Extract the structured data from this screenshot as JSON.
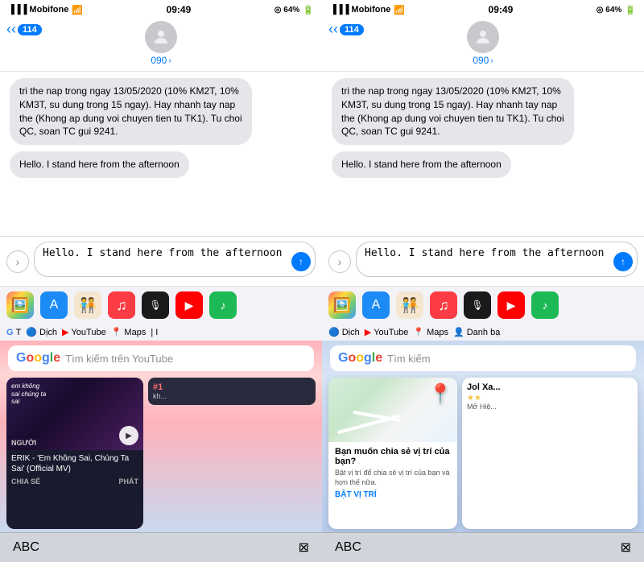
{
  "panels": [
    {
      "id": "panel-left",
      "statusBar": {
        "carrier": "Mobifone",
        "time": "09:49",
        "battery": "64%"
      },
      "header": {
        "backLabel": "114",
        "contactName": "090",
        "chevron": ">"
      },
      "messages": [
        {
          "type": "received",
          "text": "tri the nap trong ngay 13/05/2020 (10% KM2T, 10% KM3T, su dung trong 15 ngay). Hay nhanh tay nap the (Khong ap dung voi chuyen tien tu TK1). Tu choi QC, soan TC gui 9241."
        },
        {
          "type": "sent",
          "text": "Hello. I stand here from the afternoon"
        }
      ],
      "inputPlaceholder": "Hello. I stand here from the afternoon",
      "appIcons": [
        {
          "name": "photos",
          "bg": "#f0f0f0",
          "emoji": "🖼️"
        },
        {
          "name": "appstore",
          "bg": "#1c8bf5",
          "emoji": "🅐"
        },
        {
          "name": "memoji",
          "bg": "#f5c518",
          "emoji": "🧑‍🤝‍🧑"
        },
        {
          "name": "music",
          "bg": "#fc3c44",
          "emoji": "🎵"
        },
        {
          "name": "clubhouse",
          "bg": "#1a1a1a",
          "emoji": "🎙️"
        },
        {
          "name": "youtube",
          "bg": "#ff0000",
          "emoji": "▶"
        },
        {
          "name": "spotify",
          "bg": "#1db954",
          "emoji": "♪"
        }
      ],
      "quickLinks": [
        {
          "label": "G T",
          "type": "google"
        },
        {
          "label": "Dịch",
          "type": "translate",
          "color": "#4285f4"
        },
        {
          "label": "YouTube",
          "type": "youtube",
          "color": "#ff0000"
        },
        {
          "label": "Maps",
          "type": "maps",
          "color": "#ff3b30"
        },
        {
          "label": "| I",
          "type": "info"
        }
      ],
      "searchPlaceholder": "Tìm kiếm trên YouTube",
      "videoCard": {
        "title": "ERIK - 'Em Không Sai, Chúng Ta Sai' (Official MV)",
        "actionLeft": "CHIA SẺ",
        "actionRight": "PHÁT",
        "badgeText": "#1"
      },
      "keyboard": {
        "label": "ABC",
        "closeIcon": "⊠"
      }
    },
    {
      "id": "panel-right",
      "statusBar": {
        "carrier": "Mobifone",
        "time": "09:49",
        "battery": "64%"
      },
      "header": {
        "backLabel": "114",
        "contactName": "090",
        "chevron": ">"
      },
      "messages": [
        {
          "type": "received",
          "text": "tri the nap trong ngay 13/05/2020 (10% KM2T, 10% KM3T, su dung trong 15 ngay). Hay nhanh tay nap the (Khong ap dung voi chuyen tien tu TK1). Tu choi QC, soan TC gui 9241."
        },
        {
          "type": "sent",
          "text": "Hello. I stand here from the afternoon"
        }
      ],
      "inputPlaceholder": "Hello. I stand here from the afternoon",
      "appIcons": [
        {
          "name": "photos",
          "bg": "#f0f0f0",
          "emoji": "🖼️"
        },
        {
          "name": "appstore",
          "bg": "#1c8bf5",
          "emoji": "🅐"
        },
        {
          "name": "memoji",
          "bg": "#f5c518",
          "emoji": "🧑‍🤝‍🧑"
        },
        {
          "name": "music",
          "bg": "#fc3c44",
          "emoji": "🎵"
        },
        {
          "name": "clubhouse",
          "bg": "#1a1a1a",
          "emoji": "🎙️"
        },
        {
          "name": "youtube",
          "bg": "#ff0000",
          "emoji": "▶"
        },
        {
          "name": "spotify",
          "bg": "#1db954",
          "emoji": "♪"
        }
      ],
      "quickLinks": [
        {
          "label": "Dịch",
          "type": "translate",
          "color": "#4285f4"
        },
        {
          "label": "YouTube",
          "type": "youtube",
          "color": "#ff0000"
        },
        {
          "label": "Maps",
          "type": "maps",
          "color": "#ff3b30"
        },
        {
          "label": "Danh bạ",
          "type": "contacts",
          "color": "#4285f4"
        }
      ],
      "searchPlaceholder": "Tìm kiếm",
      "mapsCard": {
        "title": "Bạn muốn chia sẻ vị trí của bạn?",
        "desc": "Bật vị trí để chia sẻ vị trí của bạn và hơn thế nữa.",
        "actionLabel": "BẬT VỊ TRÍ"
      },
      "partialCard": {
        "title": "Jol Xa...",
        "stars": "★★",
        "desc": "Mở\nHiệ..."
      },
      "keyboard": {
        "label": "ABC",
        "closeIcon": "⊠"
      }
    }
  ]
}
